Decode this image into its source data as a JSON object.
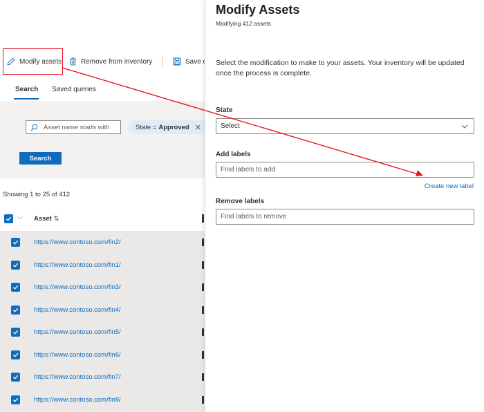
{
  "toolbar": {
    "modify_label": "Modify assets",
    "remove_label": "Remove from inventory",
    "save_label": "Save q"
  },
  "tabs": [
    {
      "label": "Search",
      "active": true
    },
    {
      "label": "Saved queries",
      "active": false
    }
  ],
  "filters": {
    "search_placeholder": "Asset name starts with",
    "pill_key": "State =",
    "pill_value": "Approved",
    "search_button": "Search"
  },
  "results": {
    "showing": "Showing 1 to 25 of 412",
    "column_asset": "Asset",
    "rows": [
      "https://www.contoso.com/fin2/",
      "https://www.contoso.com/fin1/",
      "https://www.contoso.com/fin3/",
      "https://www.contoso.com/fin4/",
      "https://www.contoso.com/fin5/",
      "https://www.contoso.com/fin6/",
      "https://www.contoso.com/fin7/",
      "https://www.contoso.com/fin8/"
    ]
  },
  "panel": {
    "title": "Modify Assets",
    "subtitle": "Modifying 412 assets",
    "description": "Select the modification to make to your assets. Your inventory will be updated once the process is complete.",
    "state_label": "State",
    "state_value": "Select",
    "add_labels_label": "Add labels",
    "add_labels_placeholder": "Find labels to add",
    "create_new_label": "Create new label",
    "remove_labels_label": "Remove labels",
    "remove_labels_placeholder": "Find labels to remove"
  },
  "colors": {
    "accent": "#0f6cbd",
    "highlight": "#e81123",
    "filter_bg": "#f3f2f1",
    "selected_row_bg": "#ebe9e7"
  }
}
